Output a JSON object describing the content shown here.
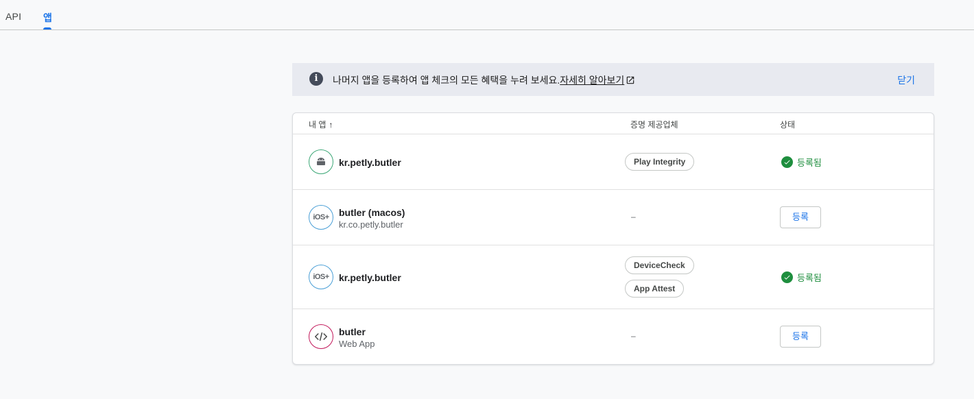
{
  "tabs": [
    {
      "label": "API"
    },
    {
      "label": "앱"
    }
  ],
  "banner": {
    "text": "나머지 앱을 등록하여 앱 체크의 모든 혜택을 누려 보세요.",
    "link": "자세히 알아보기",
    "close": "닫기"
  },
  "table": {
    "headers": {
      "app": "내 앱",
      "provider": "증명 제공업체",
      "status": "상태"
    },
    "rows": [
      {
        "platform": "android",
        "name": "kr.petly.butler",
        "sub": "",
        "providers": [
          "Play Integrity"
        ],
        "status": "등록됨",
        "action": ""
      },
      {
        "platform": "ios",
        "name": "butler (macos)",
        "sub": "kr.co.petly.butler",
        "providers": [],
        "dash": "–",
        "status": "",
        "action": "등록"
      },
      {
        "platform": "ios",
        "name": "kr.petly.butler",
        "sub": "",
        "providers": [
          "DeviceCheck",
          "App Attest"
        ],
        "status": "등록됨",
        "action": ""
      },
      {
        "platform": "web",
        "name": "butler",
        "sub": "Web App",
        "providers": [],
        "dash": "–",
        "status": "",
        "action": "등록"
      }
    ]
  },
  "icons": {
    "ios_label": "iOS+"
  },
  "colors": {
    "accent": "#1a73e8",
    "success": "#1e8e3e",
    "android": "#3ba776",
    "ios": "#4a9fd6",
    "web": "#c2185b"
  }
}
